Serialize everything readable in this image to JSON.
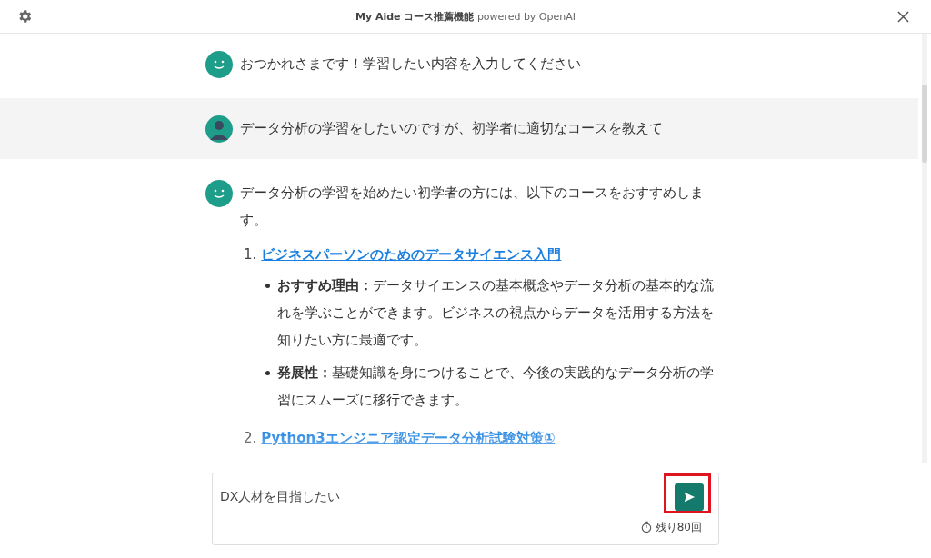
{
  "window": {
    "title": "My Aide コース推薦機能",
    "subtitle": "powered by OpenAI"
  },
  "messages": [
    {
      "kind": "bot",
      "text": "おつかれさまです！学習したい内容を入力してください"
    },
    {
      "kind": "user",
      "text": "データ分析の学習をしたいのですが、初学者に適切なコースを教えて"
    },
    {
      "kind": "bot",
      "text": "データ分析の学習を始めたい初学者の方には、以下のコースをおすすめします。",
      "courses": [
        {
          "number": "1.",
          "title": "ビジネスパーソンのためのデータサイエンス入門",
          "points": [
            "**おすすめ理由：**データサイエンスの基本概念やデータ分析の基本的な流れを学ぶことができます。ビジネスの視点からデータを活用する方法を知りたい方に最適です。",
            "**発展性：**基礎知識を身につけることで、今後の実践的なデータ分析の学習にスムーズに移行できます。"
          ]
        },
        {
          "number": "2.",
          "title": "Python3エンジニア認定データ分析試験対策①"
        }
      ]
    }
  ],
  "composer": {
    "value": "DX人材を目指したい",
    "remaining": "残り80回",
    "highlighted": true
  }
}
